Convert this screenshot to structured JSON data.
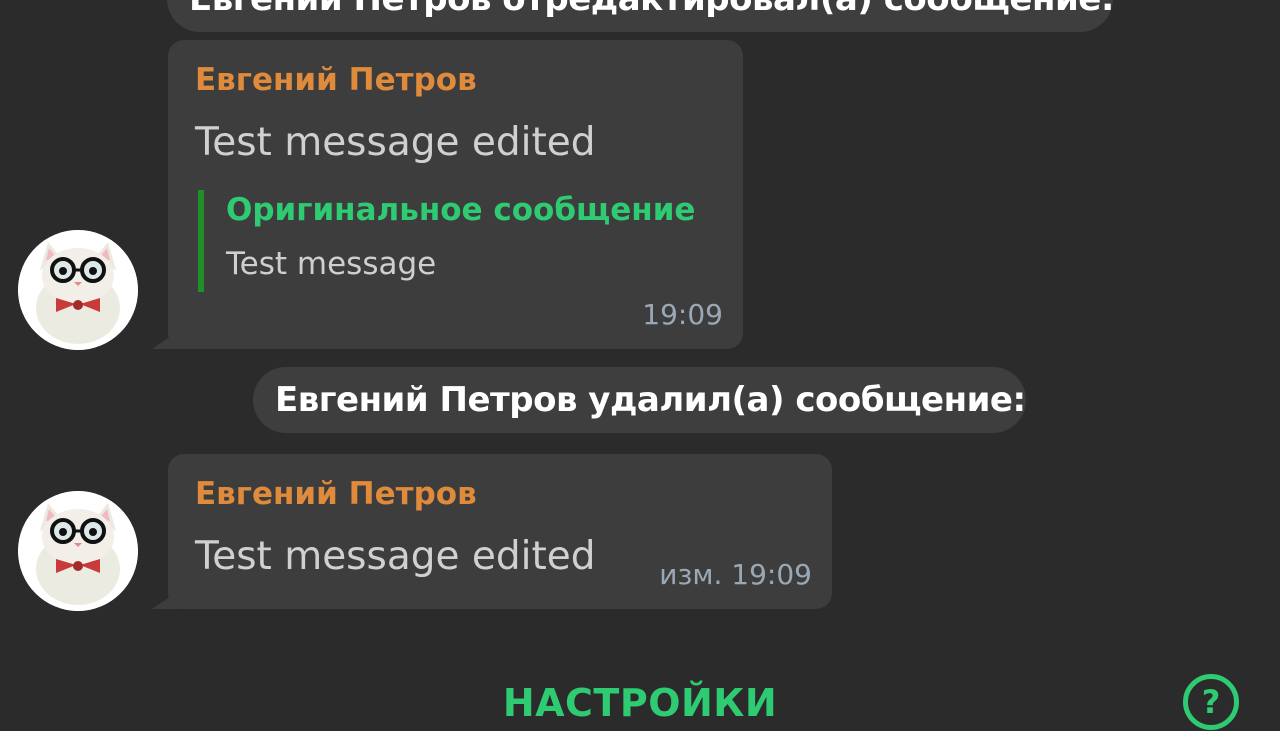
{
  "colors": {
    "background": "#2b2b2b",
    "bubble": "#3d3d3d",
    "sender_name": "#e08a3c",
    "accent_green": "#2ecb73",
    "quote_bar": "#1f8f2a",
    "time": "#9aa8b6"
  },
  "service_messages": [
    {
      "text": "Евгений Петров отредактировал(а) сообщение:"
    },
    {
      "text": "Евгений Петров удалил(а) сообщение:"
    }
  ],
  "messages": [
    {
      "sender": "Евгений Петров",
      "text": "Test message edited",
      "quote": {
        "title": "Оригинальное сообщение",
        "text": "Test message"
      },
      "time": "19:09",
      "avatar_icon": "cat-with-glasses-avatar"
    },
    {
      "sender": "Евгений Петров",
      "text": "Test message edited",
      "time": "изм. 19:09",
      "avatar_icon": "cat-with-glasses-avatar"
    }
  ],
  "bottom_bar": {
    "settings_label": "НАСТРОЙКИ",
    "help_icon": "question-circle-icon",
    "help_glyph": "?"
  }
}
